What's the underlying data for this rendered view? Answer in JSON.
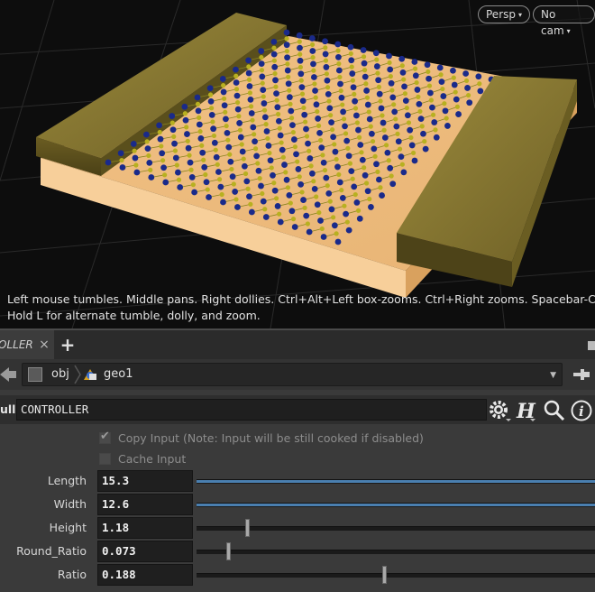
{
  "viewport": {
    "persp_label": "Persp",
    "cam_label": "No cam",
    "hint_line1": "Left mouse tumbles. Middle pans. Right dollies. Ctrl+Alt+Left box-zooms. Ctrl+Right zooms. Spacebar-Ctrl-Left tilts.",
    "hint_line2": "Hold L for alternate tumble, dolly, and zoom."
  },
  "tabs": {
    "active_label": "OLLER",
    "close_glyph": "×",
    "add_glyph": "+"
  },
  "path": {
    "crumbs": [
      {
        "label": "obj",
        "icon": "obj-network-icon"
      },
      {
        "label": "geo1",
        "icon": "geo-node-icon"
      }
    ]
  },
  "node": {
    "type_label": "ull",
    "name": "CONTROLLER"
  },
  "params": {
    "copy_input_label": "Copy Input (Note: Input will be still cooked if disabled)",
    "copy_input_checked": true,
    "cache_input_label": "Cache Input",
    "cache_input_checked": false,
    "sliders": [
      {
        "label": "Length",
        "value": "15.3",
        "level": 1.0
      },
      {
        "label": "Width",
        "value": "12.6",
        "level": 1.0
      },
      {
        "label": "Height",
        "value": "1.18",
        "level": 0.127
      },
      {
        "label": "Round_Ratio",
        "value": "0.073",
        "level": 0.079
      },
      {
        "label": "Ratio",
        "value": "0.188",
        "level": 0.471
      }
    ]
  },
  "colors": {
    "slider_fill": "#4a7fb0",
    "electrode": "#8c7a30",
    "substrate": "#f3c98f",
    "atom_blue": "#1a2a8a",
    "atom_yellow": "#b8b020"
  }
}
